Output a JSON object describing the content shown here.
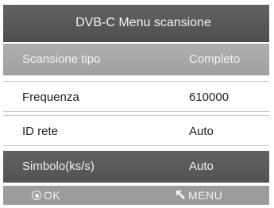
{
  "header": {
    "title": "DVB-C Menu scansione"
  },
  "rows": [
    {
      "label": "Scansione tipo",
      "value": "Completo"
    },
    {
      "label": "Frequenza",
      "value": "610000"
    },
    {
      "label": "ID rete",
      "value": "Auto"
    },
    {
      "label": "Simbolo(ks/s)",
      "value": "Auto"
    }
  ],
  "footer": {
    "ok_label": "OK",
    "ok_icon": "ok-button-icon",
    "menu_label": "MENU",
    "menu_icon": "back-arrow-icon"
  },
  "colors": {
    "header_bg": "#585a58",
    "selected_row_bg": "#a7a9a7",
    "dark_row_bg": "#595b59",
    "footer_bg": "#9b9d9b",
    "text_light": "#f3f3f3",
    "text_dark": "#1e1e1e"
  }
}
